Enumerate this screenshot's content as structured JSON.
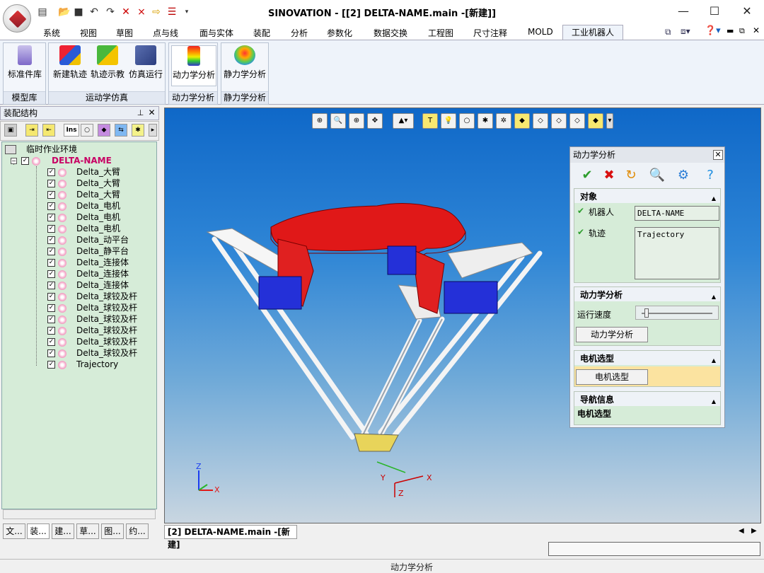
{
  "window": {
    "title": "SINOVATION - [[2] DELTA-NAME.main -[新建]]",
    "minimize": "—",
    "maximize": "☐",
    "close": "✕"
  },
  "menus": [
    "系统",
    "视图",
    "草图",
    "点与线",
    "面与实体",
    "装配",
    "分析",
    "参数化",
    "数据交换",
    "工程图",
    "尺寸注释",
    "MOLD",
    "工业机器人"
  ],
  "ribbon": {
    "buttons": [
      {
        "label": "标准件库",
        "icon": "standard-parts-icon"
      },
      {
        "label": "新建轨迹",
        "icon": "new-trajectory-icon"
      },
      {
        "label": "轨迹示教",
        "icon": "trajectory-teach-icon"
      },
      {
        "label": "仿真运行",
        "icon": "simulation-run-icon"
      },
      {
        "label": "动力学分析",
        "icon": "dynamics-icon"
      },
      {
        "label": "静力学分析",
        "icon": "statics-icon"
      }
    ],
    "groups": [
      "模型库",
      "运动学仿真",
      "动力学分析",
      "静力学分析"
    ]
  },
  "panel": {
    "title": "装配结构",
    "toolbar_ins": "Ins",
    "tree": {
      "env": "临时作业环境",
      "root": "DELTA-NAME",
      "children": [
        "Delta_大臂",
        "Delta_大臂",
        "Delta_大臂",
        "Delta_电机",
        "Delta_电机",
        "Delta_电机",
        "Delta_动平台",
        "Delta_静平台",
        "Delta_连接体",
        "Delta_连接体",
        "Delta_连接体",
        "Delta_球铰及杆",
        "Delta_球铰及杆",
        "Delta_球铰及杆",
        "Delta_球铰及杆",
        "Delta_球铰及杆",
        "Delta_球铰及杆",
        "Trajectory"
      ]
    },
    "bottom_tabs": [
      "文...",
      "装...",
      "建...",
      "草...",
      "图...",
      "约..."
    ]
  },
  "viewport": {
    "axis_labels": {
      "z": "Z",
      "y": "Y",
      "x": "X"
    }
  },
  "dialog": {
    "title": "动力学分析",
    "sections": {
      "object": {
        "title": "对象",
        "robot_label": "机器人",
        "robot_value": "DELTA-NAME",
        "traj_label": "轨迹",
        "traj_value": "Trajectory"
      },
      "analysis": {
        "title": "动力学分析",
        "speed_label": "运行速度",
        "button": "动力学分析"
      },
      "motor": {
        "title": "电机选型",
        "button": "电机选型"
      },
      "nav": {
        "title": "导航信息",
        "text": "电机选型"
      }
    }
  },
  "doc_tab": "[2] DELTA-NAME.main -[新建]",
  "status": "动力学分析",
  "colors": {
    "accent": "#c80064",
    "viewport_top": "#0f68c8",
    "red_part": "#e02020",
    "blue_part": "#2430d8"
  }
}
